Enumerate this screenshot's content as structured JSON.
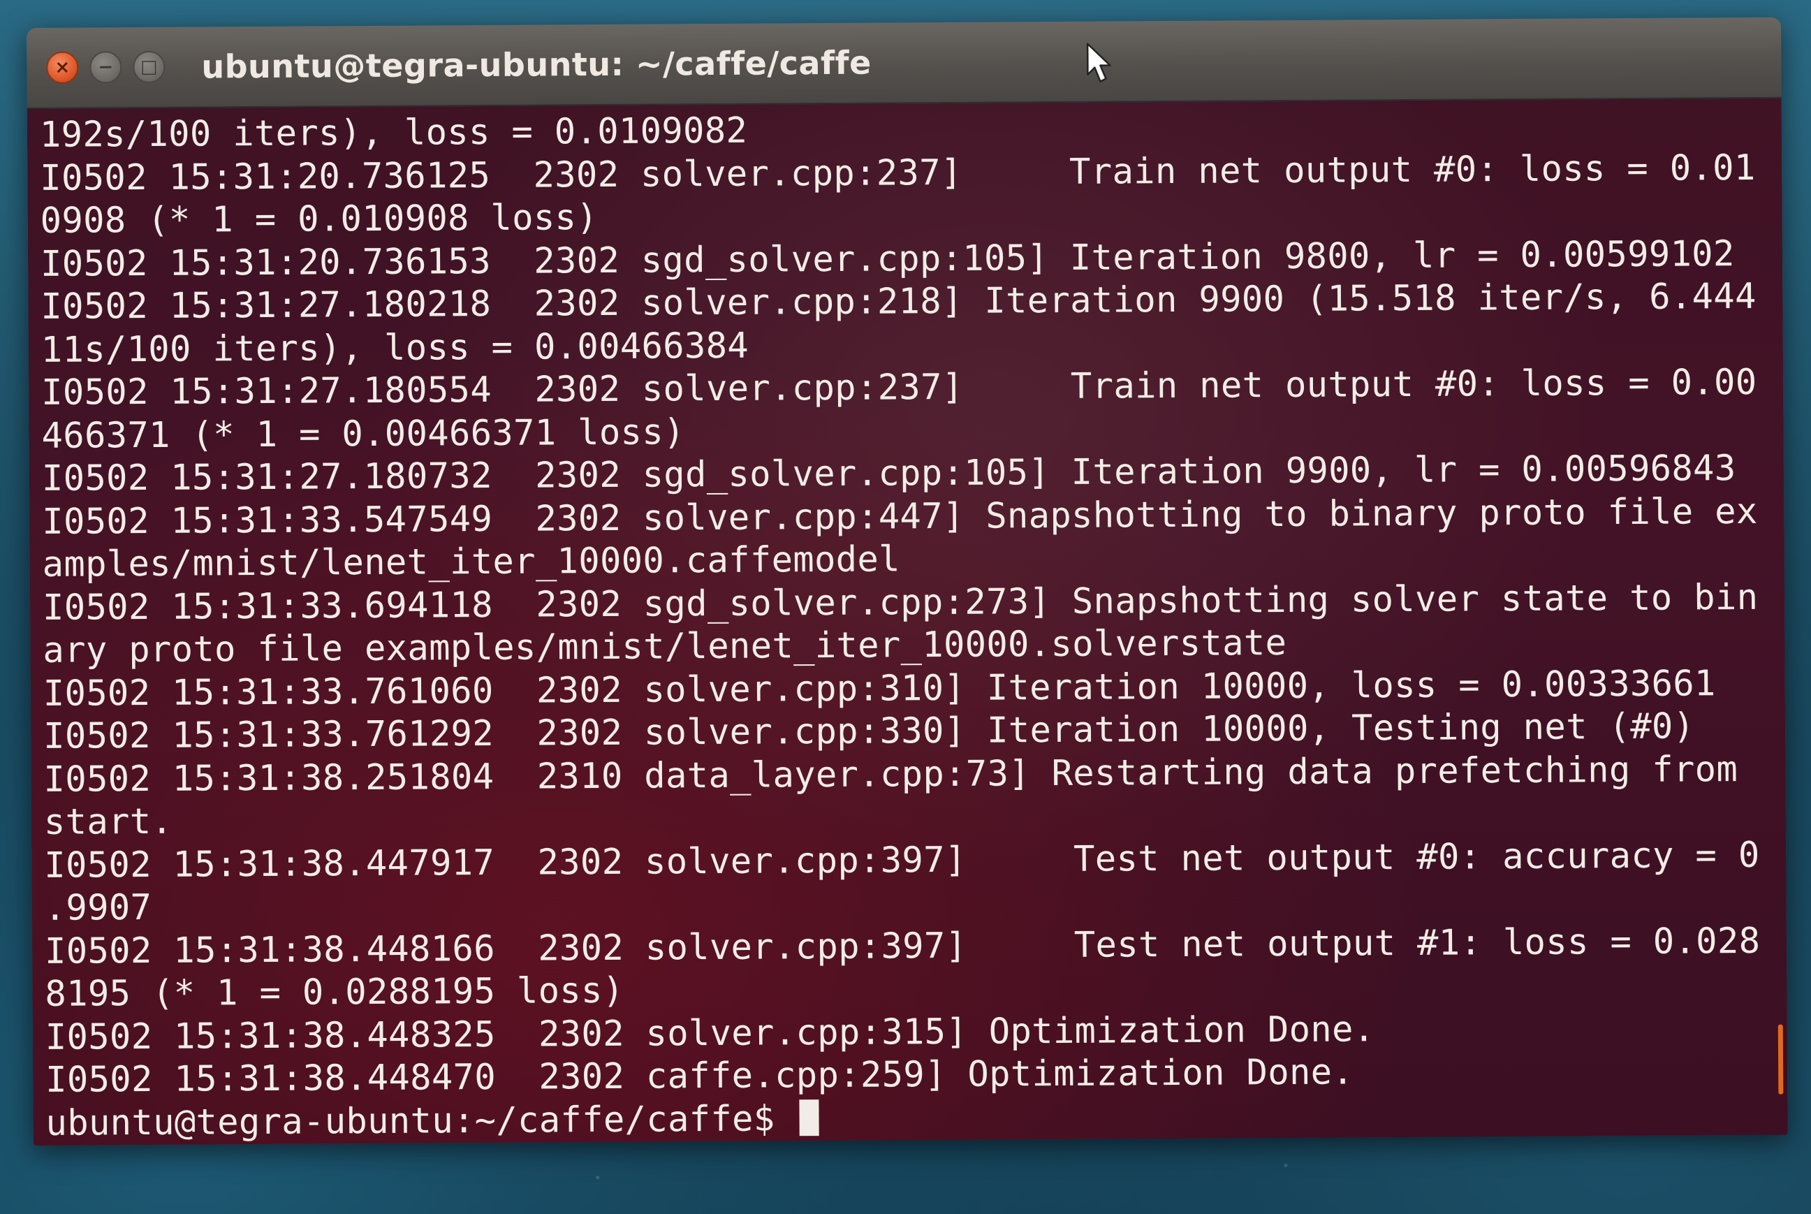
{
  "window": {
    "title": "ubuntu@tegra-ubuntu: ~/caffe/caffe",
    "controls": {
      "close_glyph": "×",
      "minimize_glyph": "−",
      "maximize_glyph": "□"
    }
  },
  "terminal": {
    "lines": [
      "192s/100 iters), loss = 0.0109082",
      "I0502 15:31:20.736125  2302 solver.cpp:237]     Train net output #0: loss = 0.01",
      "0908 (* 1 = 0.010908 loss)",
      "I0502 15:31:20.736153  2302 sgd_solver.cpp:105] Iteration 9800, lr = 0.00599102",
      "I0502 15:31:27.180218  2302 solver.cpp:218] Iteration 9900 (15.518 iter/s, 6.444",
      "11s/100 iters), loss = 0.00466384",
      "I0502 15:31:27.180554  2302 solver.cpp:237]     Train net output #0: loss = 0.00",
      "466371 (* 1 = 0.00466371 loss)",
      "I0502 15:31:27.180732  2302 sgd_solver.cpp:105] Iteration 9900, lr = 0.00596843",
      "I0502 15:31:33.547549  2302 solver.cpp:447] Snapshotting to binary proto file ex",
      "amples/mnist/lenet_iter_10000.caffemodel",
      "I0502 15:31:33.694118  2302 sgd_solver.cpp:273] Snapshotting solver state to bin",
      "ary proto file examples/mnist/lenet_iter_10000.solverstate",
      "I0502 15:31:33.761060  2302 solver.cpp:310] Iteration 10000, loss = 0.00333661",
      "I0502 15:31:33.761292  2302 solver.cpp:330] Iteration 10000, Testing net (#0)",
      "I0502 15:31:38.251804  2310 data_layer.cpp:73] Restarting data prefetching from",
      "start.",
      "I0502 15:31:38.447917  2302 solver.cpp:397]     Test net output #0: accuracy = 0",
      ".9907",
      "I0502 15:31:38.448166  2302 solver.cpp:397]     Test net output #1: loss = 0.028",
      "8195 (* 1 = 0.0288195 loss)",
      "I0502 15:31:38.448325  2302 solver.cpp:315] Optimization Done.",
      "I0502 15:31:38.448470  2302 caffe.cpp:259] Optimization Done."
    ],
    "prompt": "ubuntu@tegra-ubuntu:~/caffe/caffe$ "
  },
  "colors": {
    "terminal_bg": "#431226",
    "terminal_fg": "#f1ede6",
    "titlebar_bg": "#54514d",
    "close_button": "#e0592b",
    "scroll_indicator": "#e0691f"
  }
}
